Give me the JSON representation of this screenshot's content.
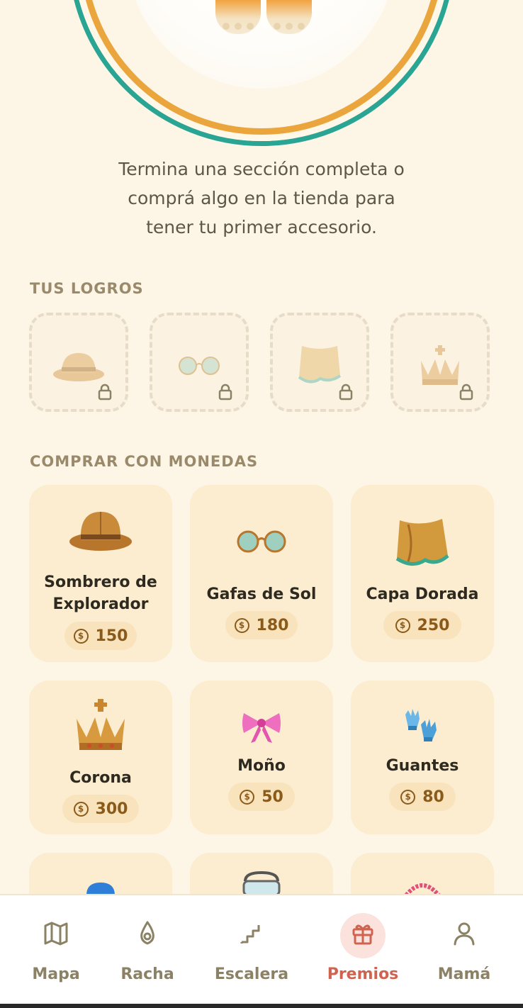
{
  "message": {
    "line1": "Termina una sección completa o",
    "line2": "comprá algo en la tienda para",
    "line3": "tener tu primer accesorio."
  },
  "achievements": {
    "title": "TUS LOGROS",
    "items": [
      {
        "icon": "explorer-hat-icon",
        "locked": true
      },
      {
        "icon": "sunglasses-icon",
        "locked": true
      },
      {
        "icon": "golden-cape-icon",
        "locked": true
      },
      {
        "icon": "crown-icon",
        "locked": true
      }
    ]
  },
  "shop": {
    "title": "COMPRAR CON MONEDAS",
    "items": [
      {
        "name_line1": "Sombrero de",
        "name_line2": "Explorador",
        "price": "150",
        "icon": "explorer-hat-icon"
      },
      {
        "name": "Gafas de Sol",
        "price": "180",
        "icon": "sunglasses-icon"
      },
      {
        "name": "Capa Dorada",
        "price": "250",
        "icon": "golden-cape-icon"
      },
      {
        "name": "Corona",
        "price": "300",
        "icon": "crown-icon"
      },
      {
        "name": "Moño",
        "price": "50",
        "icon": "bow-icon"
      },
      {
        "name": "Guantes",
        "price": "80",
        "icon": "gloves-icon"
      }
    ],
    "coin_symbol": "$"
  },
  "nav": {
    "items": [
      {
        "label": "Mapa",
        "icon": "map-icon"
      },
      {
        "label": "Racha",
        "icon": "flame-icon"
      },
      {
        "label": "Escalera",
        "icon": "stairs-icon"
      },
      {
        "label": "Premios",
        "icon": "gift-icon",
        "active": true
      },
      {
        "label": "Mamá",
        "icon": "user-icon"
      }
    ]
  },
  "colors": {
    "background": "#fdf6e6",
    "card": "#fcedd0",
    "accent_active": "#d0634f",
    "ring_teal": "#2aa594",
    "ring_orange": "#eaa63c"
  }
}
